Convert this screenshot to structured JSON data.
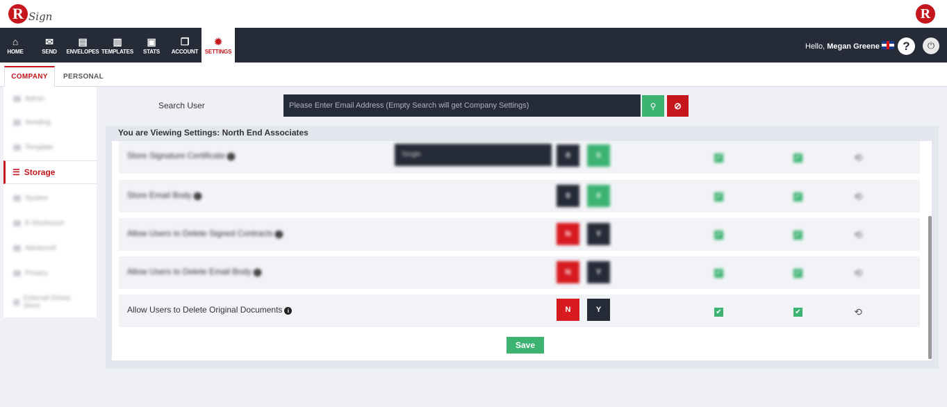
{
  "brand": {
    "logo_letter": "R",
    "logo_text": "Sign"
  },
  "nav": {
    "items": [
      {
        "label": "HOME",
        "icon": "home-icon",
        "glyph": "⌂"
      },
      {
        "label": "SEND",
        "icon": "envelope-icon",
        "glyph": "✉"
      },
      {
        "label": "ENVELOPES",
        "icon": "envelopes-icon",
        "glyph": "▤"
      },
      {
        "label": "TEMPLATES",
        "icon": "templates-icon",
        "glyph": "▥"
      },
      {
        "label": "STATS",
        "icon": "briefcase-icon",
        "glyph": "▣"
      },
      {
        "label": "ACCOUNT",
        "icon": "account-icon",
        "glyph": "❐"
      },
      {
        "label": "SETTINGS",
        "icon": "gear-icon",
        "glyph": "✹",
        "active": true
      }
    ],
    "greeting_prefix": "Hello,",
    "user_name": "Megan Greene",
    "help_glyph": "?",
    "power_glyph": "⏻"
  },
  "tabs": [
    {
      "label": "COMPANY",
      "active": true
    },
    {
      "label": "PERSONAL",
      "active": false
    }
  ],
  "sidebar": {
    "active_label": "Storage",
    "items": [
      "Admin",
      "Sending",
      "Template",
      "Storage",
      "System",
      "E-Disclosure",
      "Advanced",
      "Privacy",
      "External Drives Store"
    ]
  },
  "search": {
    "label": "Search User",
    "placeholder": "Please Enter Email Address (Empty Search will get Company Settings)",
    "search_glyph": "⚲",
    "clear_glyph": "⊘"
  },
  "panel": {
    "title": "You are Viewing Settings: North End Associates",
    "rows": [
      {
        "label": "Store Signature Certificate",
        "select_value": "Single",
        "left": "0",
        "right": "0",
        "blurred": true
      },
      {
        "label": "Store Email Body",
        "left": "0",
        "right": "0",
        "blurred": true
      },
      {
        "label": "Allow Users to Delete Signed Contracts",
        "left": "N",
        "right": "Y",
        "blurred": true
      },
      {
        "label": "Allow Users to Delete Email Body",
        "left": "N",
        "right": "Y",
        "blurred": true
      },
      {
        "label": "Allow Users to Delete Original Documents",
        "left": "N",
        "right": "Y",
        "blurred": false
      }
    ],
    "check_glyph": "✔",
    "history_glyph": "⟲",
    "save_label": "Save"
  },
  "colors": {
    "accent_red": "#c4161c",
    "nav_dark": "#262b38",
    "green": "#3cb371"
  }
}
